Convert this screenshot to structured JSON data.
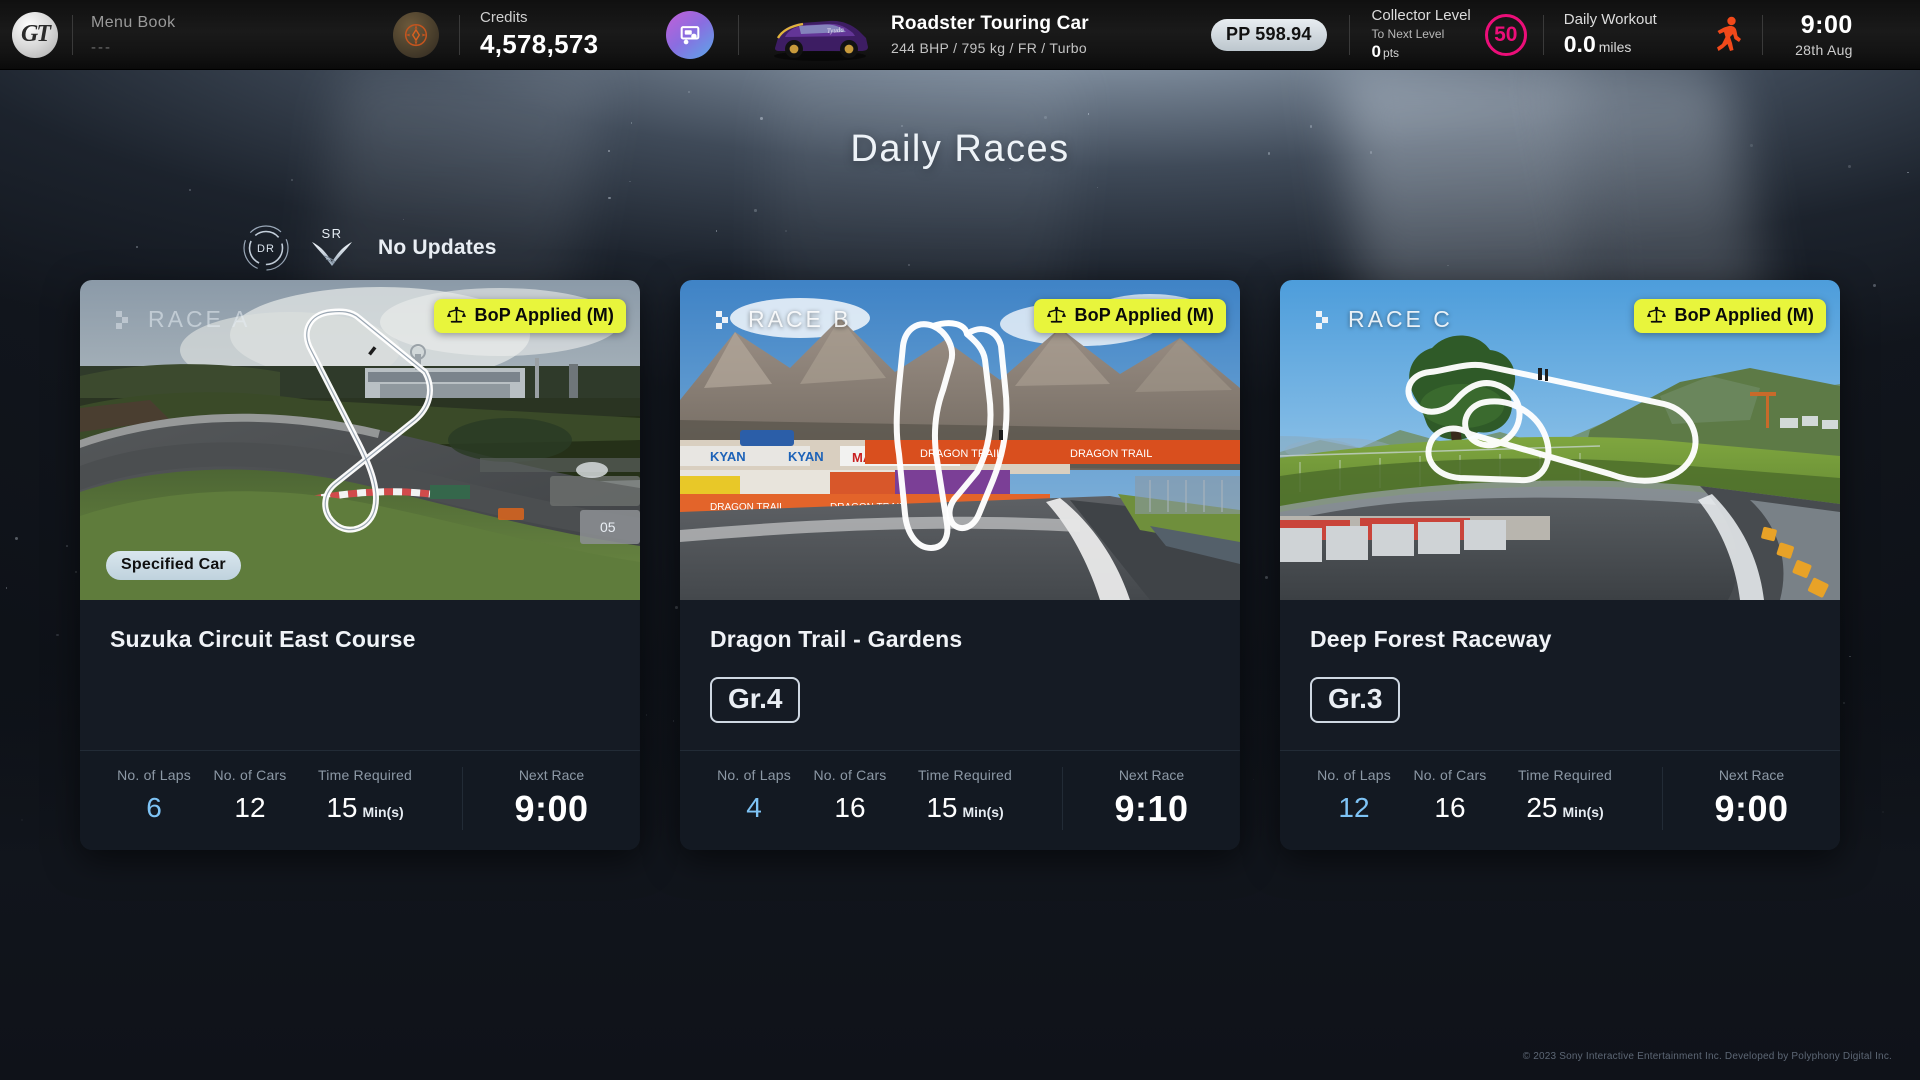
{
  "header": {
    "logo_alt": "GT",
    "menu_book": {
      "title": "Menu Book",
      "subtitle": "---"
    },
    "credits": {
      "label": "Credits",
      "value": "4,578,573"
    },
    "car": {
      "name": "Roadster Touring Car",
      "specs": "244 BHP / 795 kg / FR / Turbo",
      "pp": "PP 598.94"
    },
    "collector": {
      "label": "Collector Level",
      "sub_label": "To Next Level",
      "points": "0",
      "points_unit": "pts",
      "level": "50",
      "level_color": "#ec0e79"
    },
    "workout": {
      "label": "Daily Workout",
      "value": "0.0",
      "unit": "miles"
    },
    "clock": {
      "time": "9:00",
      "date": "28th Aug"
    }
  },
  "page": {
    "title": "Daily Races"
  },
  "rank_bar": {
    "dr_label": "DR",
    "sr_label": "SR",
    "status": "No Updates"
  },
  "cards": [
    {
      "race_label": "RACE A",
      "bop": "BoP Applied (M)",
      "spec_car_label": "Specified Car",
      "track": "Suzuka Circuit East Course",
      "category": null,
      "stats": [
        {
          "label": "No. of Laps",
          "value": "6",
          "unit": null
        },
        {
          "label": "No. of Cars",
          "value": "12",
          "unit": null
        },
        {
          "label": "Time Required",
          "value": "15",
          "unit": "Min(s)"
        }
      ],
      "next_race_label": "Next Race",
      "next_race_time": "9:00"
    },
    {
      "race_label": "RACE B",
      "bop": "BoP Applied (M)",
      "spec_car_label": null,
      "track": "Dragon Trail - Gardens",
      "category": "Gr.4",
      "stats": [
        {
          "label": "No. of Laps",
          "value": "4",
          "unit": null
        },
        {
          "label": "No. of Cars",
          "value": "16",
          "unit": null
        },
        {
          "label": "Time Required",
          "value": "15",
          "unit": "Min(s)"
        }
      ],
      "next_race_label": "Next Race",
      "next_race_time": "9:10"
    },
    {
      "race_label": "RACE C",
      "bop": "BoP Applied (M)",
      "spec_car_label": null,
      "track": "Deep Forest Raceway",
      "category": "Gr.3",
      "stats": [
        {
          "label": "No. of Laps",
          "value": "12",
          "unit": null
        },
        {
          "label": "No. of Cars",
          "value": "16",
          "unit": null
        },
        {
          "label": "Time Required",
          "value": "25",
          "unit": "Min(s)"
        }
      ],
      "next_race_label": "Next Race",
      "next_race_time": "9:00"
    }
  ],
  "footer": {
    "copyright": "© 2023 Sony Interactive Entertainment Inc. Developed by Polyphony Digital Inc."
  },
  "colors": {
    "bop_badge": "#e8f53c",
    "laps_accent": "#7ec3f5",
    "level_ring": "#ec0e79",
    "workout_icon": "#f2491a"
  }
}
